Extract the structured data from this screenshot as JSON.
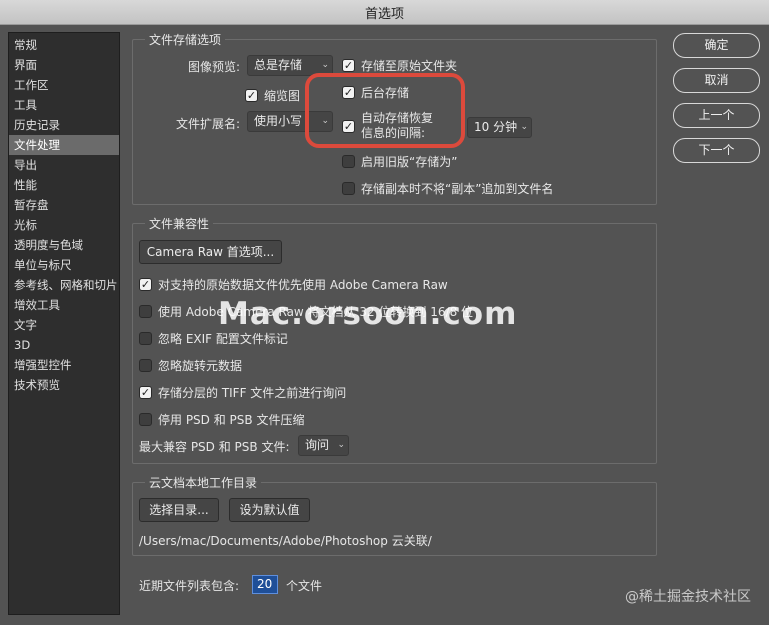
{
  "window": {
    "title": "首选项"
  },
  "sidebar": {
    "items": [
      {
        "label": "常规"
      },
      {
        "label": "界面"
      },
      {
        "label": "工作区"
      },
      {
        "label": "工具"
      },
      {
        "label": "历史记录"
      },
      {
        "label": "文件处理"
      },
      {
        "label": "导出"
      },
      {
        "label": "性能"
      },
      {
        "label": "暂存盘"
      },
      {
        "label": "光标"
      },
      {
        "label": "透明度与色域"
      },
      {
        "label": "单位与标尺"
      },
      {
        "label": "参考线、网格和切片"
      },
      {
        "label": "增效工具"
      },
      {
        "label": "文字"
      },
      {
        "label": "3D"
      },
      {
        "label": "增强型控件"
      },
      {
        "label": "技术预览"
      }
    ],
    "active": "文件处理"
  },
  "file_saving": {
    "title": "文件存储选项",
    "image_preview_label": "图像预览:",
    "image_preview_value": "总是存储",
    "save_original_folder": {
      "label": "存储至原始文件夹",
      "checked": true
    },
    "thumbnail": {
      "label": "缩览图",
      "checked": true
    },
    "background_save": {
      "label": "后台存储",
      "checked": true
    },
    "ext_label": "文件扩展名:",
    "ext_value": "使用小写",
    "autosave": {
      "label_line1": "自动存储恢复",
      "label_line2": "信息的间隔:",
      "checked": true
    },
    "autosave_interval": "10 分钟",
    "legacy_save_as": {
      "label": "启用旧版“存储为”",
      "checked": false
    },
    "no_copy_suffix": {
      "label": "存储副本时不将“副本”追加到文件名",
      "checked": false
    }
  },
  "compat": {
    "title": "文件兼容性",
    "camera_raw_button": "Camera Raw 首选项...",
    "options": [
      {
        "label": "对支持的原始数据文件优先使用 Adobe Camera Raw",
        "checked": true
      },
      {
        "label": "使用 Adobe Camera Raw 将文档从 32 位转换到 16/8 位",
        "checked": false
      },
      {
        "label": "忽略 EXIF 配置文件标记",
        "checked": false
      },
      {
        "label": "忽略旋转元数据",
        "checked": false
      },
      {
        "label": "存储分层的 TIFF 文件之前进行询问",
        "checked": true
      },
      {
        "label": "停用 PSD 和 PSB 文件压缩",
        "checked": false
      }
    ],
    "max_compat_label": "最大兼容 PSD 和 PSB 文件:",
    "max_compat_value": "询问"
  },
  "cloud": {
    "title": "云文档本地工作目录",
    "choose_button": "选择目录...",
    "default_button": "设为默认值",
    "path": "/Users/mac/Documents/Adobe/Photoshop 云关联/"
  },
  "recent": {
    "label": "近期文件列表包含:",
    "value": "20",
    "suffix": "个文件"
  },
  "buttons": {
    "ok": "确定",
    "cancel": "取消",
    "prev": "上一个",
    "next": "下一个"
  },
  "watermark": "Mac.orsoon.com",
  "corner_watermark": "@稀土掘金技术社区",
  "colors": {
    "highlight": "#dc4a3c",
    "panel": "#535353",
    "sidebar": "#2e2e2e",
    "selection": "#6b6b6b"
  }
}
